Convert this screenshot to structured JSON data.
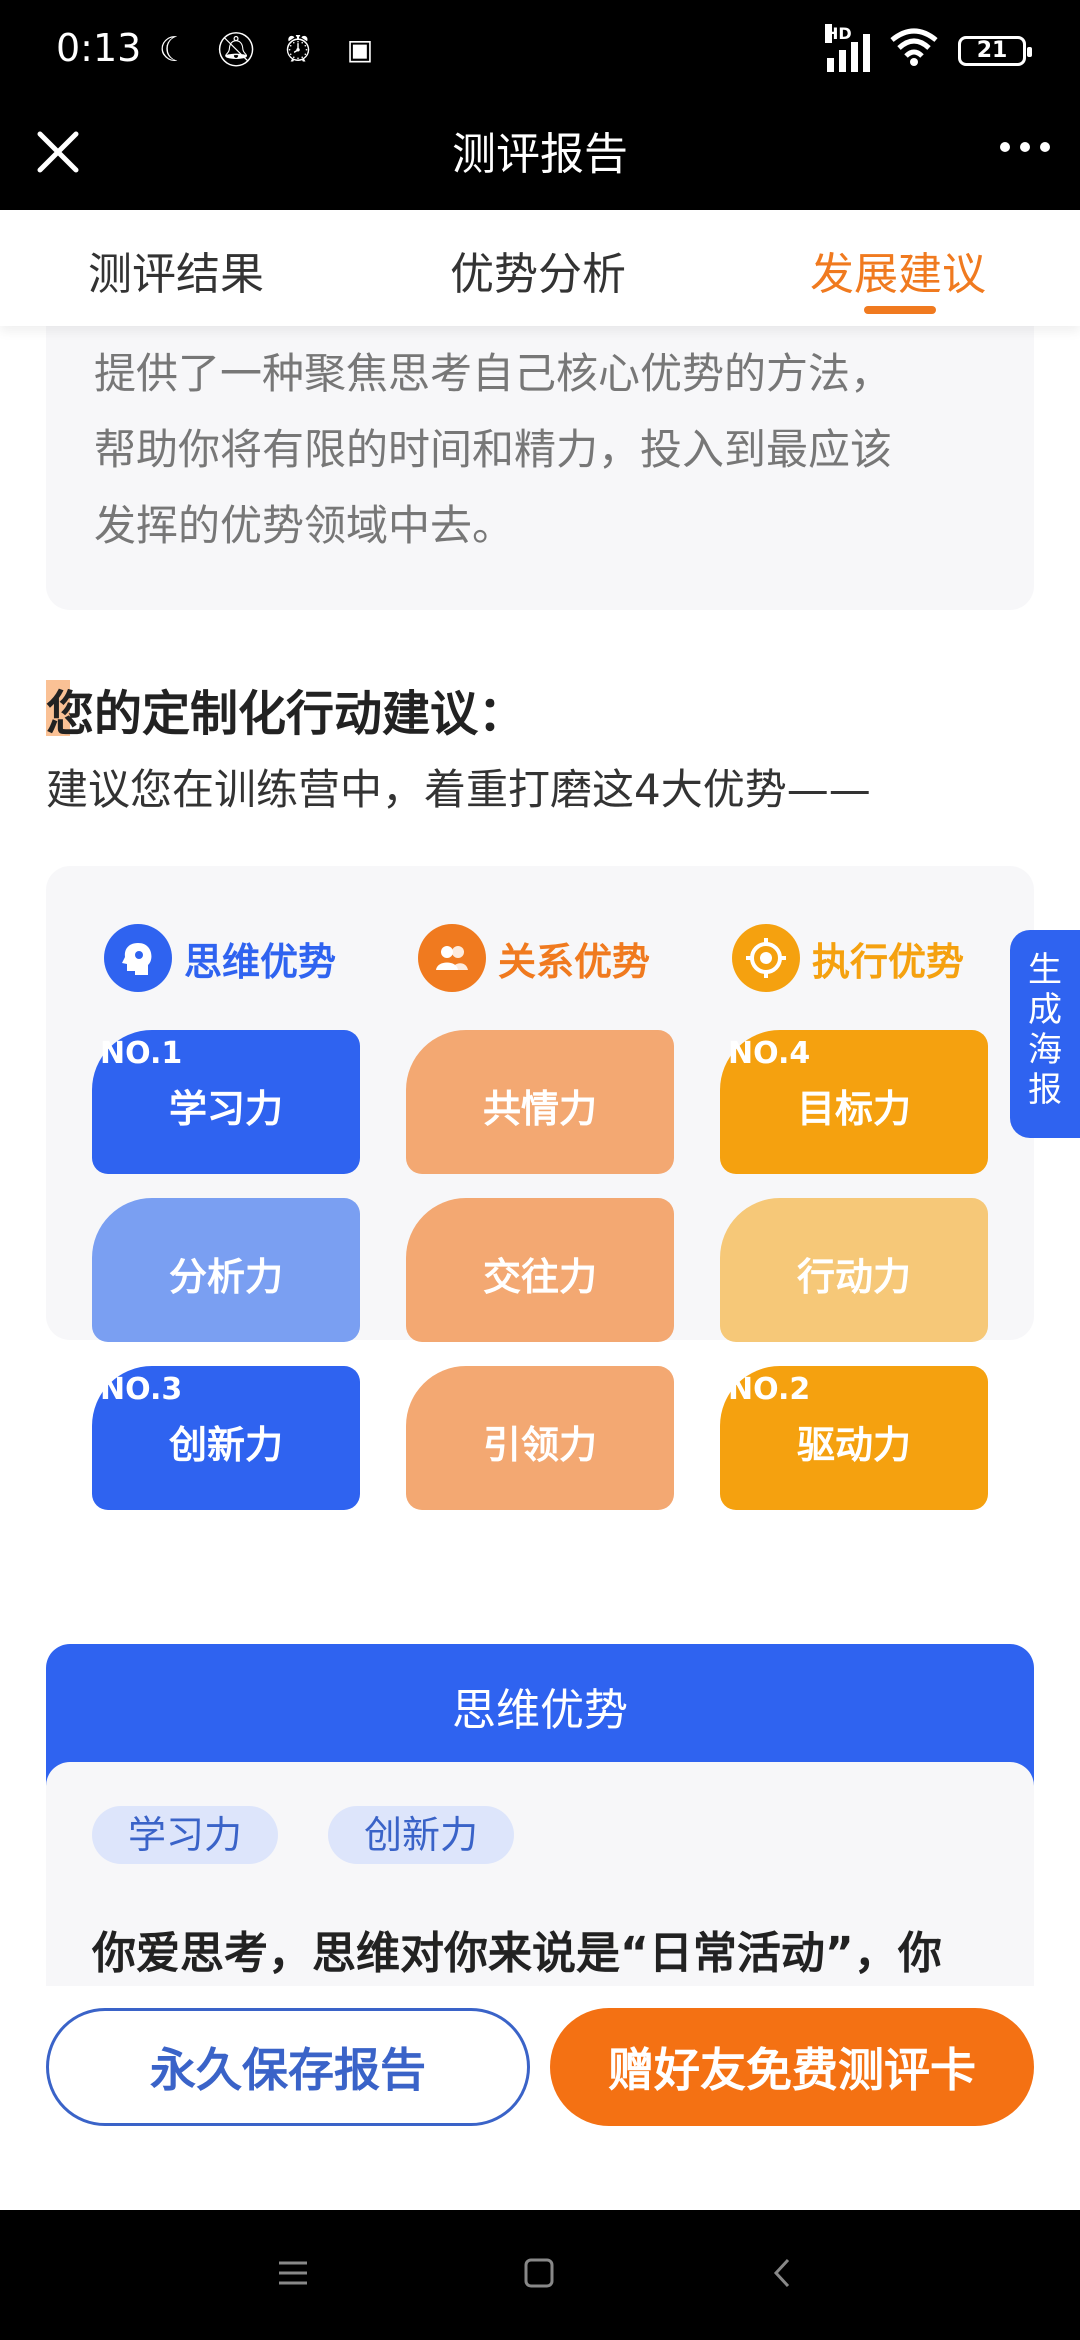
{
  "status": {
    "time": "0:13",
    "battery": "21",
    "network_badge": "HD",
    "icons_left": [
      "moon-icon",
      "bell-off-icon",
      "alarm-icon",
      "app-icon"
    ]
  },
  "header": {
    "title": "测评报告"
  },
  "tabs": [
    {
      "label": "测评结果",
      "active": false
    },
    {
      "label": "优势分析",
      "active": false
    },
    {
      "label": "发展建议",
      "active": true
    }
  ],
  "intro": {
    "lines": [
      "提供了一种聚焦思考自己核心优势的方法，",
      "帮助你将有限的时间和精力，投入到最应该",
      "发挥的优势领域中去。"
    ]
  },
  "action": {
    "title": "您的定制化行动建议：",
    "subtitle": "建议您在训练营中，着重打磨这4大优势——"
  },
  "categories": [
    {
      "label": "思维优势",
      "color": "#2f63f0",
      "icon": "head-icon"
    },
    {
      "label": "关系优势",
      "color": "#f07a1f",
      "icon": "people-icon"
    },
    {
      "label": "执行优势",
      "color": "#f5a10f",
      "icon": "target-icon"
    }
  ],
  "tiles": [
    [
      {
        "name": "学习力",
        "rank": "NO.1",
        "color": "#2f63f0"
      },
      {
        "name": "分析力",
        "rank": "",
        "color": "#7a9ff2"
      },
      {
        "name": "创新力",
        "rank": "NO.3",
        "color": "#2f63f0"
      }
    ],
    [
      {
        "name": "共情力",
        "rank": "",
        "color": "#f3a872"
      },
      {
        "name": "交往力",
        "rank": "",
        "color": "#f3a872"
      },
      {
        "name": "引领力",
        "rank": "",
        "color": "#f3a872"
      }
    ],
    [
      {
        "name": "目标力",
        "rank": "NO.4",
        "color": "#f5a10f"
      },
      {
        "name": "行动力",
        "rank": "",
        "color": "#f6c878"
      },
      {
        "name": "驱动力",
        "rank": "NO.2",
        "color": "#f5a10f"
      }
    ]
  ],
  "side_tab": {
    "label": "生成海报"
  },
  "thinking": {
    "title": "思维优势",
    "chips": [
      "学习力",
      "创新力"
    ],
    "text": "你爱思考，思维对你来说是“日常活动”，你"
  },
  "buttons": {
    "save": "永久保存报告",
    "gift": "赠好友免费测评卡"
  },
  "colors": {
    "accent": "#f07a1f",
    "brand_blue": "#2f63f0"
  }
}
